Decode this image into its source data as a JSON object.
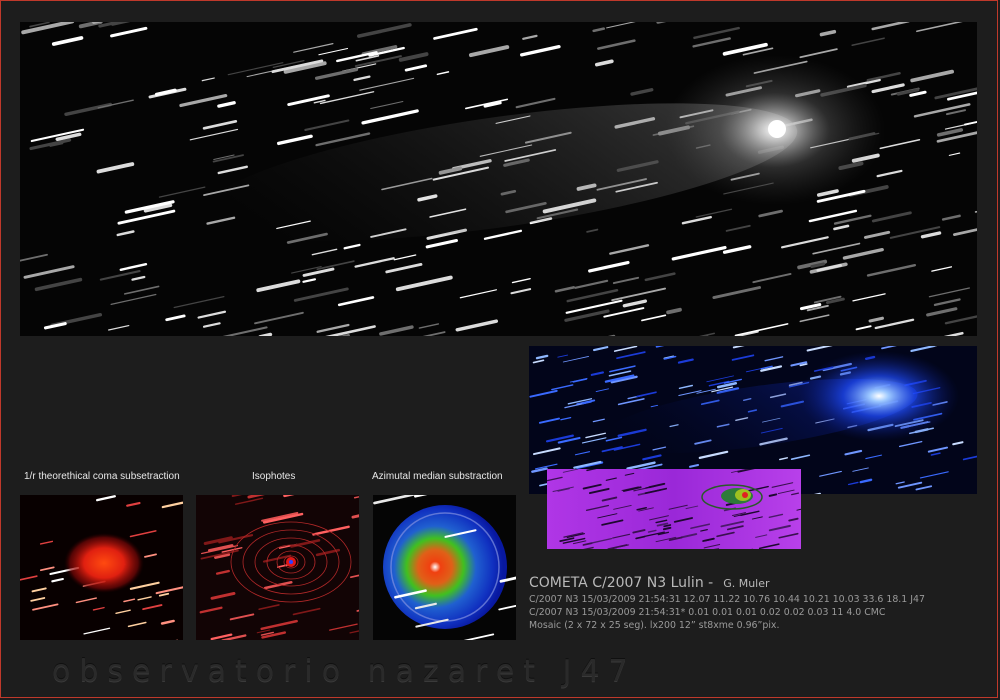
{
  "captions": {
    "coma": "1/r theorethical coma subsetraction",
    "isophotes": "Isophotes",
    "azimutal": "Azimutal median substraction"
  },
  "comet": {
    "title": "COMETA C/2007 N3  Lulin  -",
    "author": "G. Muler",
    "line1": "C/2007 N3 15/03/2009 21:54:31 12.07 11.22 10.76 10.44 10.21 10.03 33.6 18.1 J47",
    "line2": "C/2007 N3 15/03/2009 21:54:31* 0.01 0.01 0.01 0.02 0.02 0.03 11 4.0 CMC",
    "line3": "Mosaic (2 x 72 x 25 seg). lx200 12” st8xme 0.96”pix."
  },
  "watermark": "observatorio nazaret J47",
  "colors": {
    "border": "#c0392b",
    "background": "#1d1d1d",
    "caption": "#e8e8e8",
    "info_text": "#9a9a9a"
  }
}
